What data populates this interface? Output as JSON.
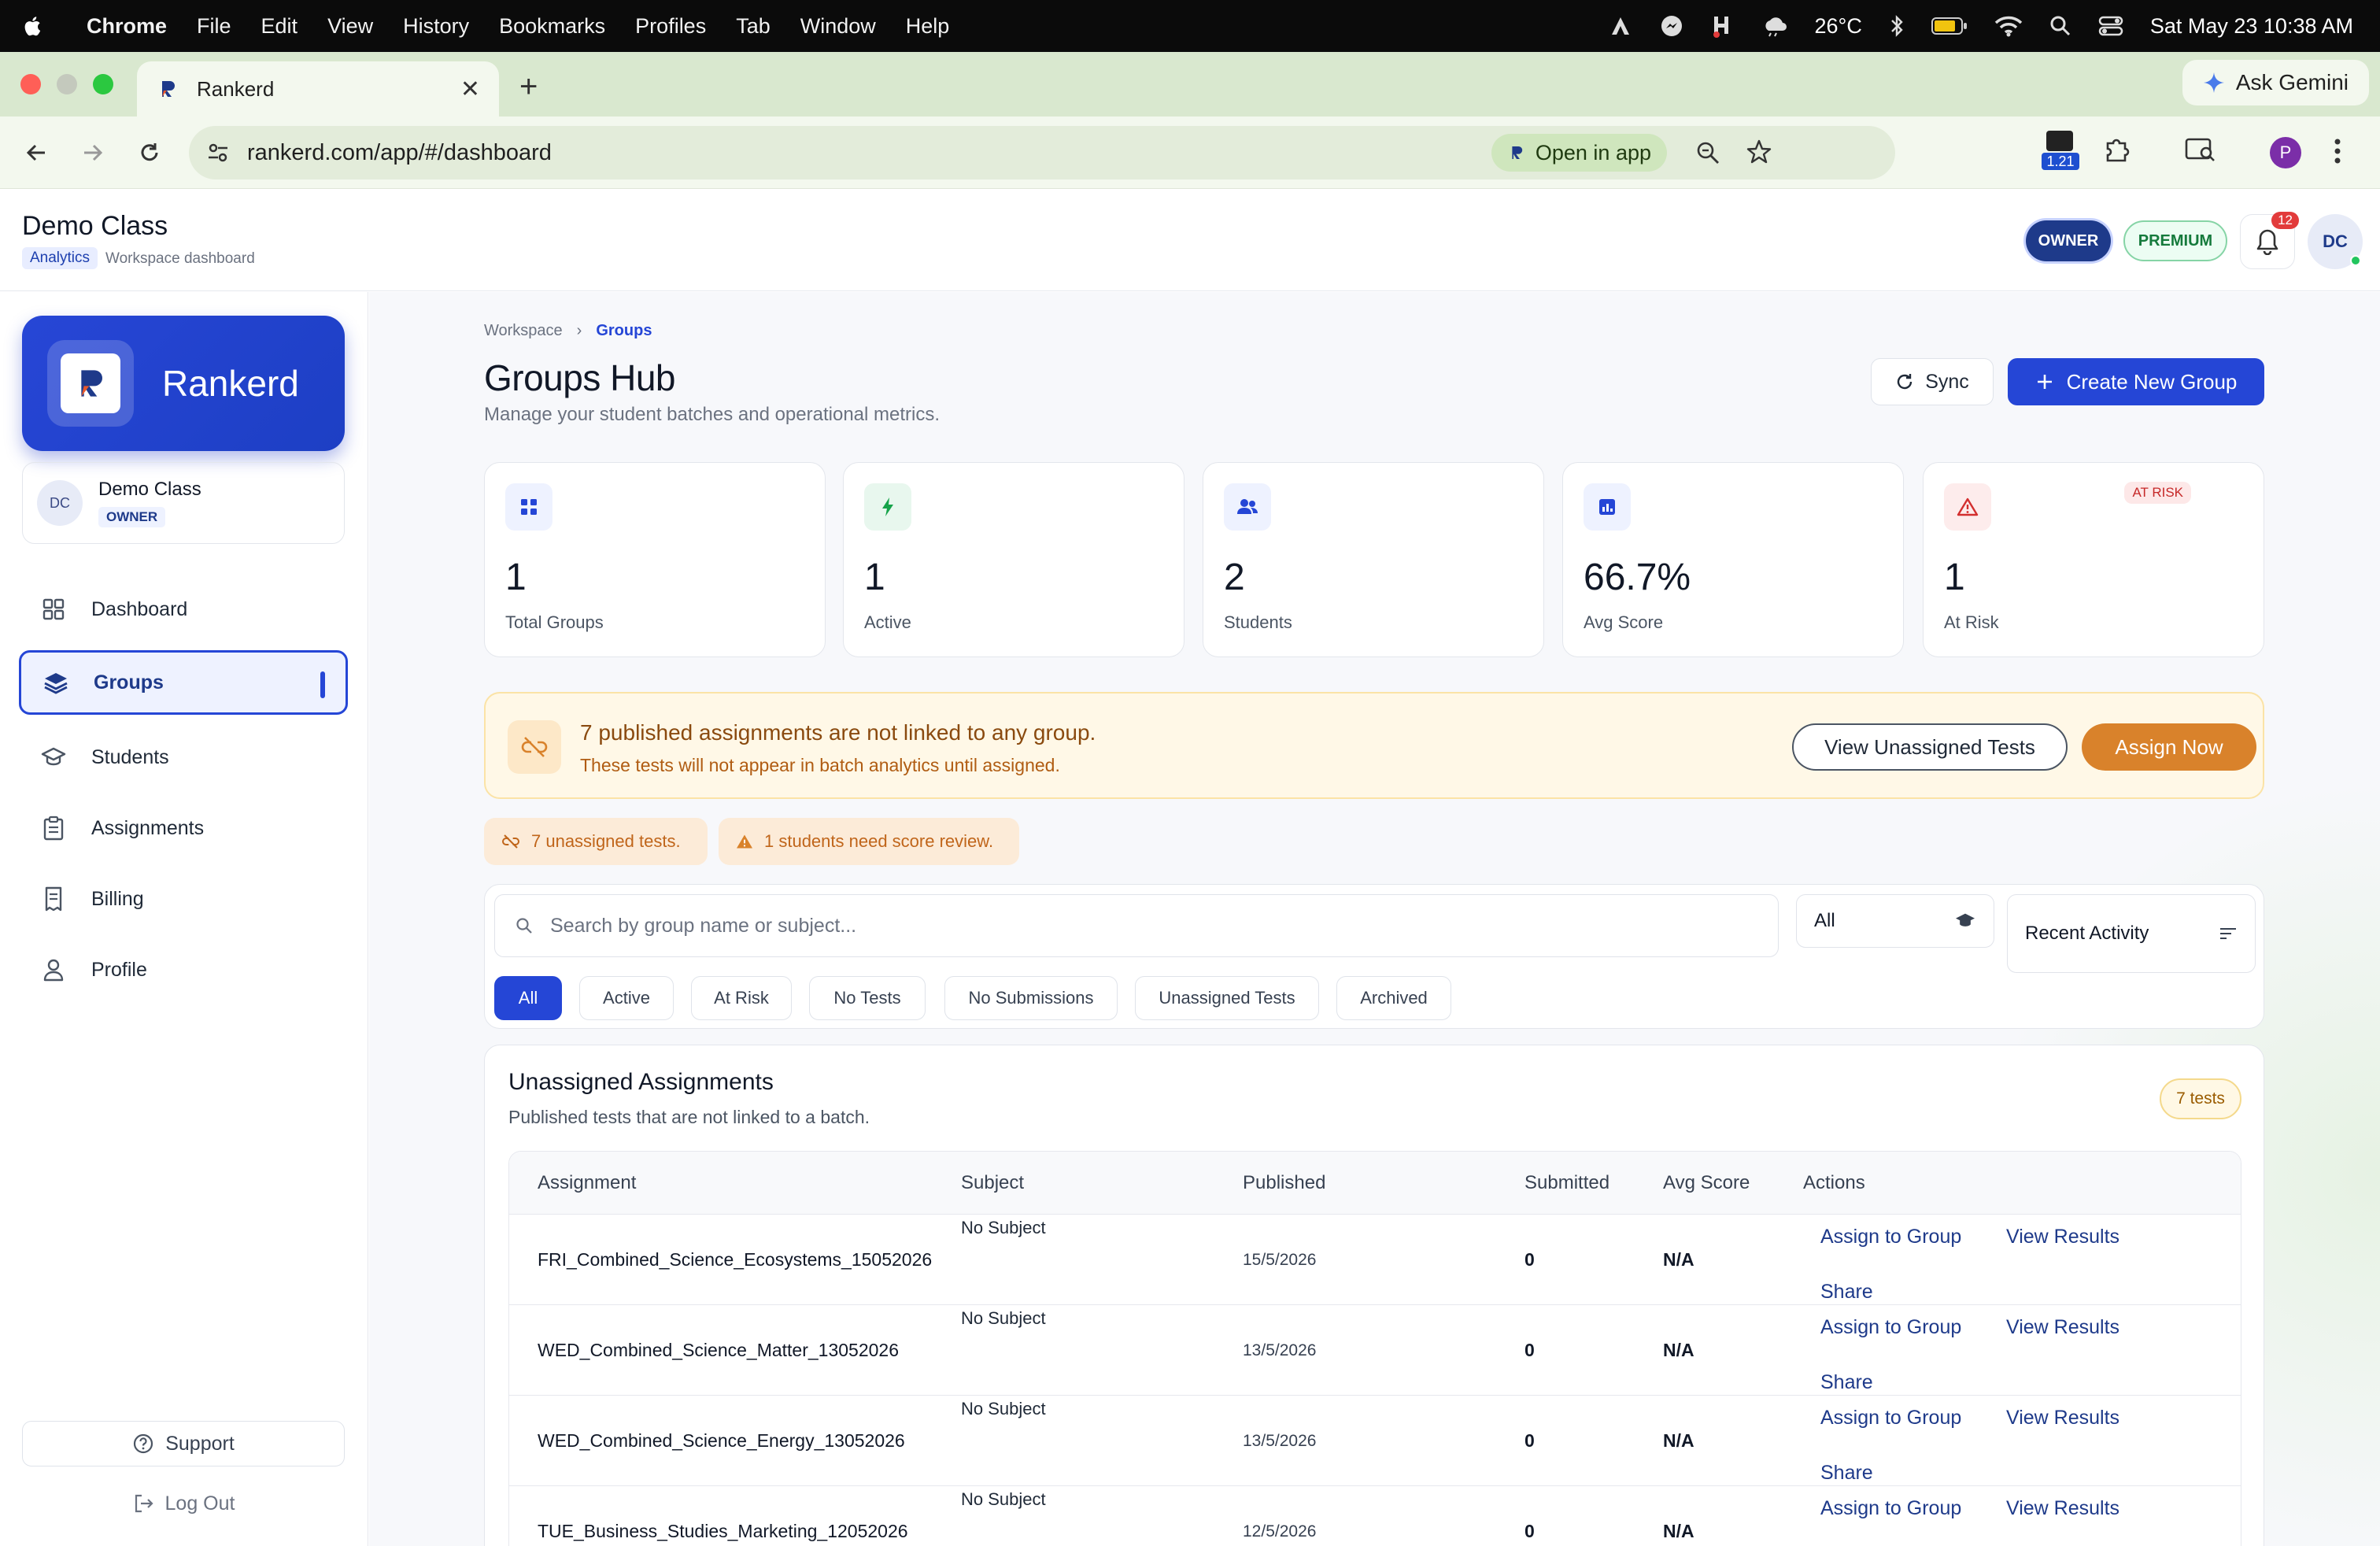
{
  "menubar": {
    "app": "Chrome",
    "items": [
      "File",
      "Edit",
      "View",
      "History",
      "Bookmarks",
      "Profiles",
      "Tab",
      "Window",
      "Help"
    ],
    "temperature": "26°C",
    "datetime": "Sat May 23  10:38 AM"
  },
  "browser": {
    "tab_title": "Rankerd",
    "ask_gemini": "Ask Gemini",
    "url": "rankerd.com/app/#/dashboard",
    "open_in_app": "Open in app",
    "ext_badge": "1.21",
    "profile_initial": "P"
  },
  "header": {
    "title": "Demo Class",
    "tag": "Analytics",
    "subtitle": "Workspace dashboard",
    "owner_pill": "OWNER",
    "premium_pill": "PREMIUM",
    "notifications": "12",
    "user_initials": "DC"
  },
  "sidebar": {
    "brand": "Rankerd",
    "workspace": {
      "initials": "DC",
      "name": "Demo Class",
      "role": "OWNER"
    },
    "items": [
      {
        "label": "Dashboard",
        "icon": "grid-icon"
      },
      {
        "label": "Groups",
        "icon": "layers-icon",
        "active": true
      },
      {
        "label": "Students",
        "icon": "graduation-cap-icon"
      },
      {
        "label": "Assignments",
        "icon": "clipboard-icon"
      },
      {
        "label": "Billing",
        "icon": "receipt-icon"
      },
      {
        "label": "Profile",
        "icon": "user-icon"
      }
    ],
    "support": "Support",
    "logout": "Log Out"
  },
  "main": {
    "breadcrumb": [
      "Workspace",
      "Groups"
    ],
    "title": "Groups Hub",
    "subtitle": "Manage your student batches and operational metrics.",
    "sync": "Sync",
    "create": "Create New Group",
    "stats": [
      {
        "value": "1",
        "label": "Total Groups",
        "icon": "grid-icon",
        "color": "#2546d6"
      },
      {
        "value": "1",
        "label": "Active",
        "icon": "bolt-icon",
        "color": "#16a34a"
      },
      {
        "value": "2",
        "label": "Students",
        "icon": "users-icon",
        "color": "#2546d6"
      },
      {
        "value": "66.7%",
        "label": "Avg Score",
        "icon": "chart-icon",
        "color": "#2546d6"
      },
      {
        "value": "1",
        "label": "At Risk",
        "icon": "alert-icon",
        "color": "#d32f2f",
        "flag": "AT RISK"
      }
    ],
    "banner": {
      "heading": "7 published assignments are not linked to any group.",
      "text": "These tests will not appear in batch analytics until assigned.",
      "view_btn": "View Unassigned Tests",
      "assign_btn": "Assign Now"
    },
    "notes": [
      "7 unassigned tests.",
      "1 students need score review."
    ],
    "search_placeholder": "Search by group name or subject...",
    "group_filter": "All",
    "sort": "Recent Activity",
    "filter_chips": [
      "All",
      "Active",
      "At Risk",
      "No Tests",
      "No Submissions",
      "Unassigned Tests",
      "Archived"
    ],
    "unassigned": {
      "heading": "Unassigned Assignments",
      "subtitle": "Published tests that are not linked to a batch.",
      "badge": "7 tests",
      "columns": [
        "Assignment",
        "Subject",
        "Published",
        "Submitted",
        "Avg Score",
        "Actions"
      ],
      "rows": [
        {
          "name": "FRI_Combined_Science_Ecosystems_15052026",
          "subject": "No Subject",
          "published": "15/5/2026",
          "submitted": "0",
          "avg": "N/A"
        },
        {
          "name": "WED_Combined_Science_Matter_13052026",
          "subject": "No Subject",
          "published": "13/5/2026",
          "submitted": "0",
          "avg": "N/A"
        },
        {
          "name": "WED_Combined_Science_Energy_13052026",
          "subject": "No Subject",
          "published": "13/5/2026",
          "submitted": "0",
          "avg": "N/A"
        },
        {
          "name": "TUE_Business_Studies_Marketing_12052026",
          "subject": "No Subject",
          "published": "12/5/2026",
          "submitted": "0",
          "avg": "N/A"
        }
      ],
      "actions": [
        "Assign to Group",
        "View Results",
        "Share"
      ]
    }
  }
}
